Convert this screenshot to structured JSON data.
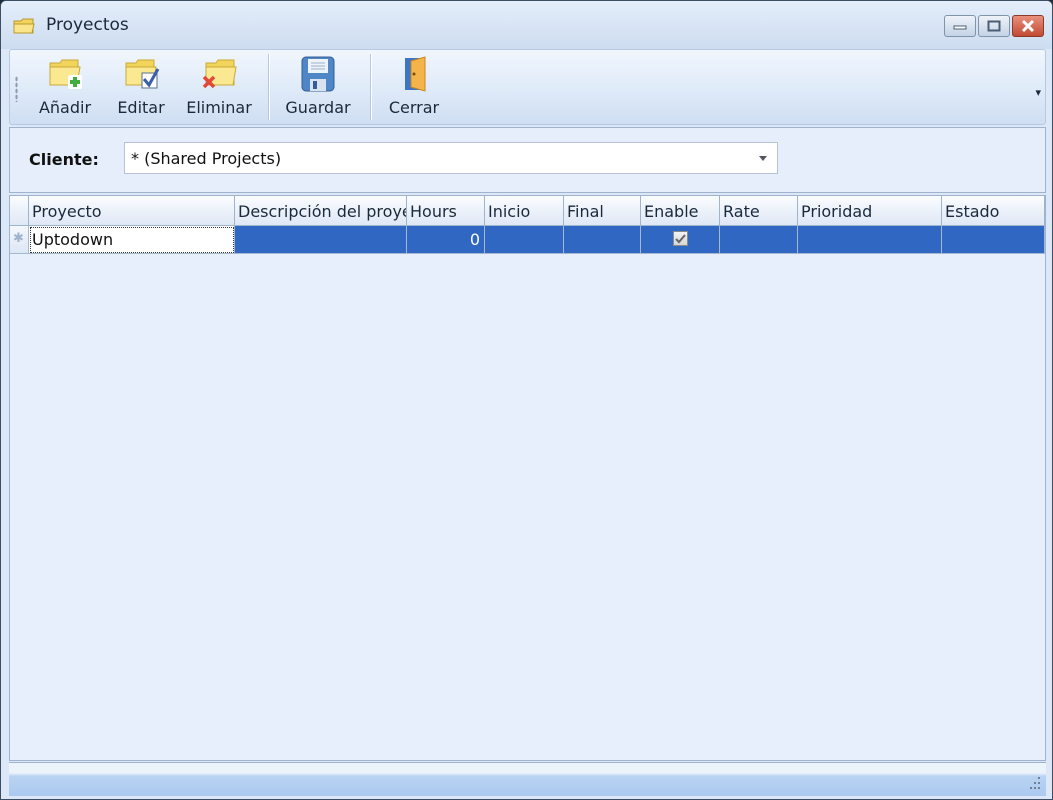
{
  "window": {
    "title": "Proyectos",
    "icon": "folder-icon",
    "controls": [
      "minimize-icon",
      "restore-icon",
      "close-icon"
    ]
  },
  "toolbar": {
    "buttons": [
      {
        "label": "Añadir",
        "icon": "folder-add-icon"
      },
      {
        "label": "Editar",
        "icon": "folder-edit-icon"
      },
      {
        "label": "Eliminar",
        "icon": "folder-delete-icon"
      },
      {
        "label": "Guardar",
        "icon": "floppy-save-icon"
      },
      {
        "label": "Cerrar",
        "icon": "door-exit-icon"
      }
    ],
    "overflow_icon": "▾"
  },
  "filter": {
    "label": "Cliente:",
    "selected": "* (Shared Projects)"
  },
  "grid": {
    "columns": [
      "Proyecto",
      "Descripción del proyecto",
      "Hours",
      "Inicio",
      "Final",
      "Enable",
      "Rate",
      "Prioridad",
      "Estado"
    ],
    "rows": [
      {
        "row_marker": "✱",
        "proyecto": "Uptodown",
        "descripcion": "",
        "hours": "0",
        "inicio": "",
        "final": "",
        "enable": true,
        "rate": "",
        "prioridad": "",
        "estado": ""
      }
    ]
  },
  "colors": {
    "selection": "#2f67c2",
    "background": "#e6effb"
  }
}
